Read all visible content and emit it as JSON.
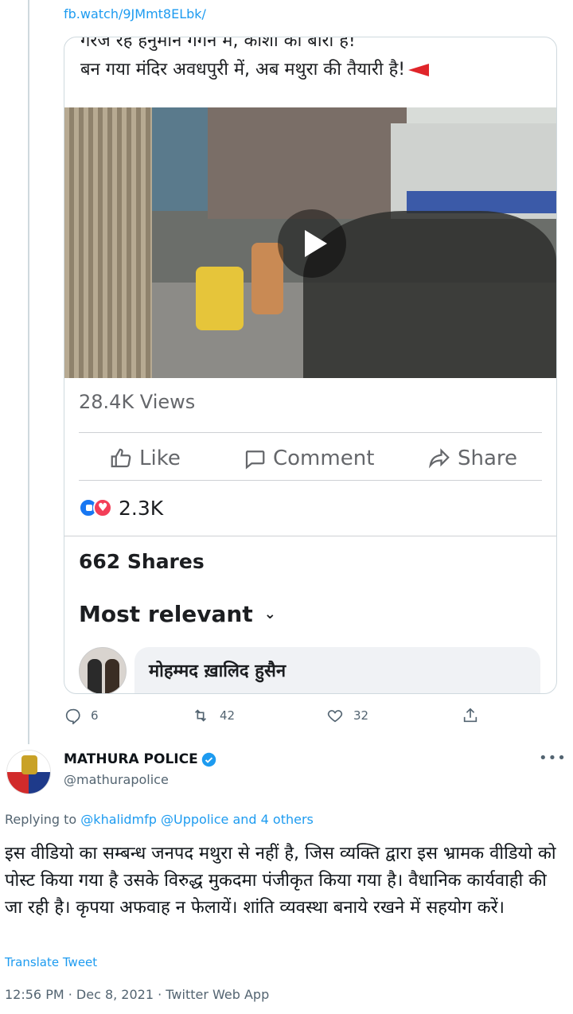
{
  "link_text": "fb.watch/9JMmt8ELbk/",
  "embed": {
    "hindi_line1": "गरज रहे हनुमान गगन में, काशी की बारी है!",
    "hindi_line2": "बन गया मंदिर अवधपुरी में, अब मथुरा की तैयारी है!",
    "flag_emoji_color": "#e0252a",
    "views": "28.4K Views",
    "actions": {
      "like": "Like",
      "comment": "Comment",
      "share": "Share"
    },
    "reactions_count": "2.3K",
    "shares": "662 Shares",
    "sort_label": "Most relevant",
    "comment_author": "मोहम्मद ख़ालिद हुसैन"
  },
  "quoted_tweet_stats": {
    "replies": "6",
    "retweets": "42",
    "likes": "32"
  },
  "tweet": {
    "display_name": "MATHURA POLICE",
    "handle": "@mathurapolice",
    "replying_prefix": "Replying to",
    "replying_mentions": "@khalidmfp @Uppolice and 4 others",
    "body": "इस वीडियो का सम्बन्ध जनपद मथुरा से नहीं है, जिस व्यक्ति द्वारा इस भ्रामक वीडियो को पोस्ट किया गया है उसके विरुद्ध मुकदमा पंजीकृत किया गया है। वैधानिक कार्यवाही की जा रही है। कृपया अफवाह न फेलायें। शांति व्यवस्था बनाये रखने में सहयोग करें।",
    "translate": "Translate Tweet",
    "meta": "12:56 PM · Dec 8, 2021 · Twitter Web App"
  },
  "colors": {
    "accent": "#1d9bf0",
    "like_blue": "#1877f2",
    "love_red": "#f33e58"
  }
}
